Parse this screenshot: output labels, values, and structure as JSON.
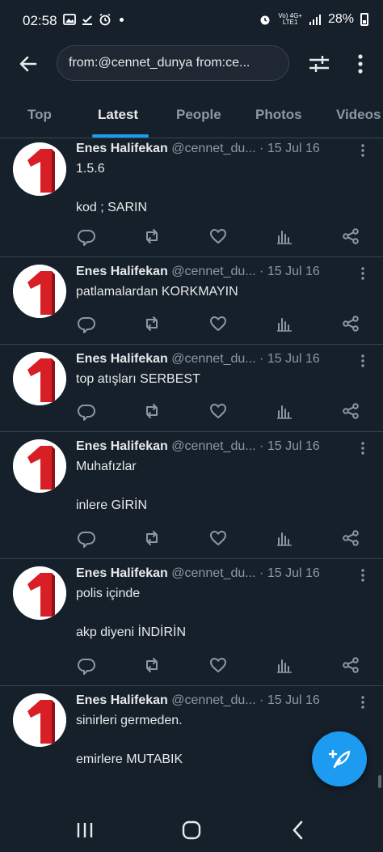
{
  "status_bar": {
    "time": "02:58",
    "network_top": "Vo) 4G+",
    "network_bottom": "LTE1",
    "battery": "28%"
  },
  "top_bar": {
    "search_query": "from:@cennet_dunya from:ce..."
  },
  "tabs": [
    {
      "label": "Top"
    },
    {
      "label": "Latest"
    },
    {
      "label": "People"
    },
    {
      "label": "Photos"
    },
    {
      "label": "Videos"
    }
  ],
  "active_tab": "Latest",
  "tweets": [
    {
      "name": "Enes Halifekan",
      "handle": "@cennet_du...",
      "date": "· 15 Jul 16",
      "lines": [
        "1.5.6",
        "",
        "kod ; SARIN"
      ]
    },
    {
      "name": "Enes Halifekan",
      "handle": "@cennet_du...",
      "date": "· 15 Jul 16",
      "lines": [
        "patlamalardan KORKMAYIN"
      ]
    },
    {
      "name": "Enes Halifekan",
      "handle": "@cennet_du...",
      "date": "· 15 Jul 16",
      "lines": [
        "top atışları SERBEST"
      ]
    },
    {
      "name": "Enes Halifekan",
      "handle": "@cennet_du...",
      "date": "· 15 Jul 16",
      "lines": [
        "Muhafızlar",
        "",
        "inlere GİRİN"
      ]
    },
    {
      "name": "Enes Halifekan",
      "handle": "@cennet_du...",
      "date": "· 15 Jul 16",
      "lines": [
        "polis içinde",
        "",
        "akp diyeni İNDİRİN"
      ]
    },
    {
      "name": "Enes Halifekan",
      "handle": "@cennet_du...",
      "date": "· 15 Jul 16",
      "lines": [
        "sinirleri germeden.",
        "",
        "emirlere MUTABIK"
      ]
    }
  ],
  "icons": {
    "back": "arrow-left-icon",
    "filter": "sliders-icon",
    "more": "vertical-dots-icon",
    "reply": "reply-icon",
    "retweet": "retweet-icon",
    "like": "heart-icon",
    "views": "views-icon",
    "share": "share-icon",
    "compose": "compose-tweet-icon"
  },
  "colors": {
    "background": "#15202b",
    "accent": "#1d9bf0",
    "text_primary": "#e7e9ea",
    "text_secondary": "#8b98a5",
    "avatar_red": "#d91f26"
  }
}
